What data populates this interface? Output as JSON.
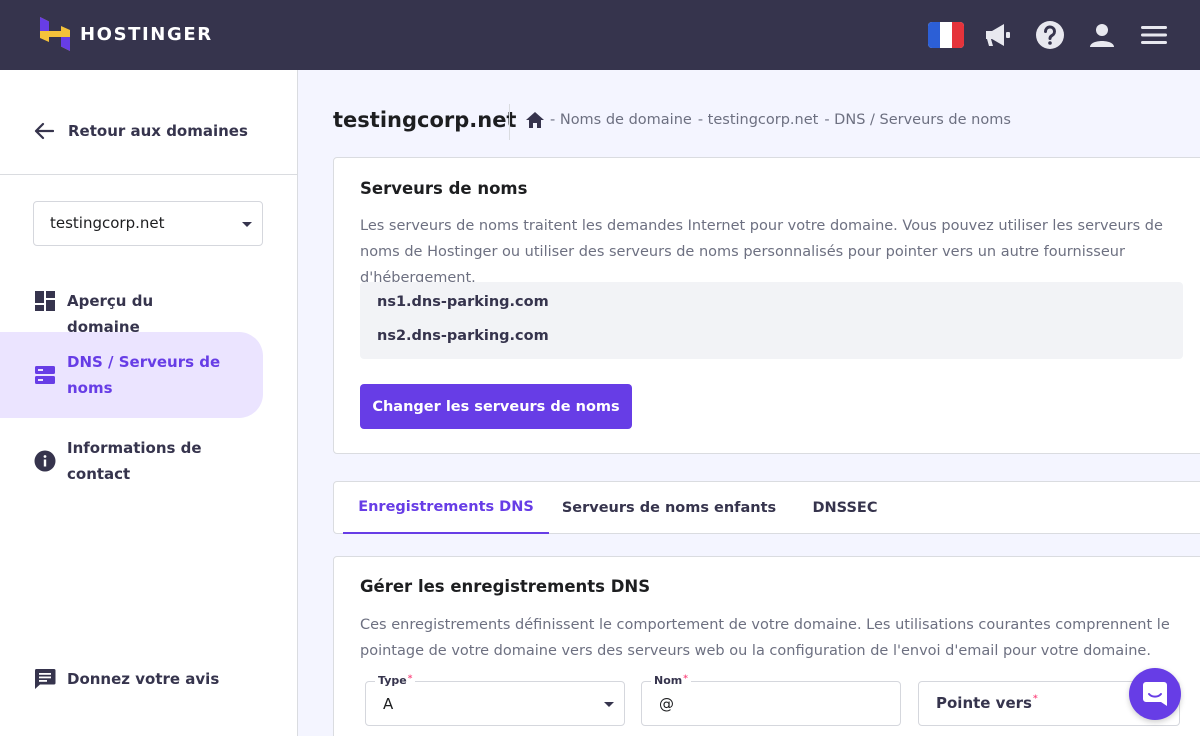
{
  "brand": {
    "name": "HOSTINGER",
    "accent": "#673de6",
    "topbar_bg": "#36344d"
  },
  "topbar": {
    "icons": [
      "flag-france-icon",
      "megaphone-icon",
      "help-icon",
      "user-icon",
      "menu-icon"
    ]
  },
  "sidebar": {
    "back_label": "Retour aux domaines",
    "domain_select_value": "testingcorp.net",
    "items": [
      {
        "label": "Aperçu du domaine",
        "icon": "dashboard-icon"
      },
      {
        "label": "DNS / Serveurs de noms",
        "icon": "server-icon",
        "active": true
      },
      {
        "label": "Informations de contact",
        "icon": "info-icon"
      }
    ],
    "feedback_label": "Donnez votre avis"
  },
  "header": {
    "title": "testingcorp.net",
    "breadcrumb": [
      "- Noms de domaine",
      "- testingcorp.net",
      "- DNS / Serveurs de noms"
    ]
  },
  "nameservers_card": {
    "title": "Serveurs de noms",
    "description": "Les serveurs de noms traitent les demandes Internet pour votre domaine. Vous pouvez utiliser les serveurs de noms de Hostinger ou utiliser des serveurs de noms personnalisés pour pointer vers un autre fournisseur d'hébergement.",
    "nameservers": [
      "ns1.dns-parking.com",
      "ns2.dns-parking.com"
    ],
    "change_button": "Changer les serveurs de noms"
  },
  "tabs": [
    {
      "label": "Enregistrements DNS",
      "active": true
    },
    {
      "label": "Serveurs de noms enfants"
    },
    {
      "label": "DNSSEC"
    }
  ],
  "dns_card": {
    "title": "Gérer les enregistrements DNS",
    "description": "Ces enregistrements définissent le comportement de votre domaine. Les utilisations courantes comprennent le pointage de votre domaine vers des serveurs web ou la configuration de l'envoi d'email pour votre domaine.",
    "type_label": "Type",
    "type_value": "A",
    "name_label": "Nom",
    "name_value": "@",
    "points_to_label": "Pointe vers",
    "required_mark": "*"
  }
}
